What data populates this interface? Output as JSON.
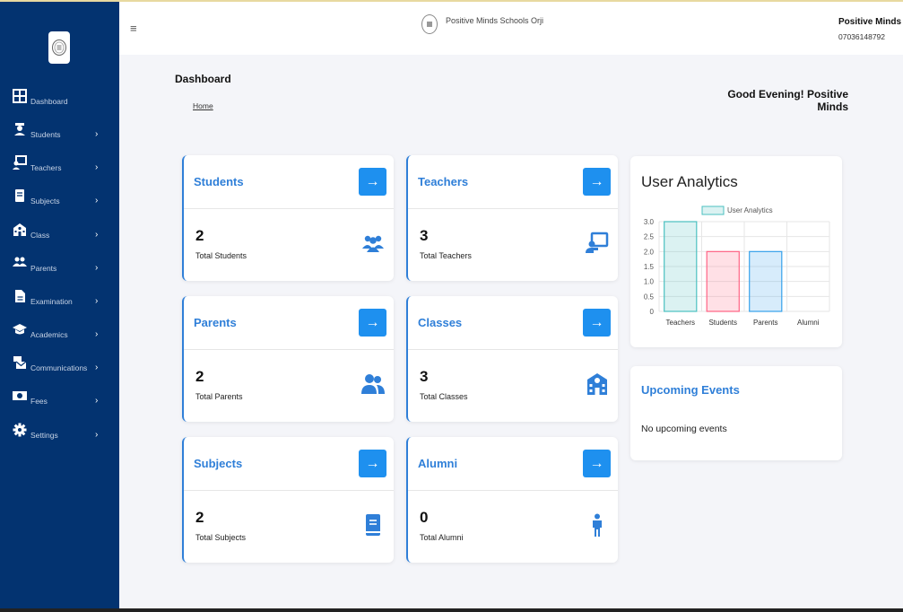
{
  "sidebar": {
    "items": [
      {
        "label": "Dashboard",
        "icon": "grid-icon",
        "chevron": ""
      },
      {
        "label": "Students",
        "icon": "student-icon",
        "chevron": "›"
      },
      {
        "label": "Teachers",
        "icon": "teacher-icon",
        "chevron": "›"
      },
      {
        "label": "Subjects",
        "icon": "book-icon",
        "chevron": "›"
      },
      {
        "label": "Class",
        "icon": "school-icon",
        "chevron": "›"
      },
      {
        "label": "Parents",
        "icon": "users-icon",
        "chevron": "›"
      },
      {
        "label": "Examination",
        "icon": "file-icon",
        "chevron": "›"
      },
      {
        "label": "Academics",
        "icon": "graduation-cap-icon",
        "chevron": "›"
      },
      {
        "label": "Communications",
        "icon": "mail-bulk-icon",
        "chevron": "›"
      },
      {
        "label": "Fees",
        "icon": "money-icon",
        "chevron": "›"
      },
      {
        "label": "Settings",
        "icon": "gear-icon",
        "chevron": "›"
      }
    ]
  },
  "header": {
    "menu_icon": "≡",
    "school_name": "Positive Minds Schools Orji",
    "user_name": "Positive Minds",
    "user_phone": "07036148792"
  },
  "page": {
    "title": "Dashboard",
    "breadcrumb": "Home",
    "greeting": "Good Evening! Positive Minds"
  },
  "cards": [
    {
      "title": "Students",
      "value": "2",
      "subtitle": "Total Students",
      "icon": "users-group-icon"
    },
    {
      "title": "Teachers",
      "value": "3",
      "subtitle": "Total Teachers",
      "icon": "chalkboard-teacher-icon"
    },
    {
      "title": "Parents",
      "value": "2",
      "subtitle": "Total Parents",
      "icon": "user-friends-icon"
    },
    {
      "title": "Classes",
      "value": "3",
      "subtitle": "Total Classes",
      "icon": "school-icon"
    },
    {
      "title": "Subjects",
      "value": "2",
      "subtitle": "Total Subjects",
      "icon": "book-icon"
    },
    {
      "title": "Alumni",
      "value": "0",
      "subtitle": "Total Alumni",
      "icon": "person-icon"
    }
  ],
  "arrow_glyph": "→",
  "analytics": {
    "title": "User Analytics"
  },
  "chart_data": {
    "type": "bar",
    "categories": [
      "Teachers",
      "Students",
      "Parents",
      "Alumni"
    ],
    "series": [
      {
        "name": "User Analytics",
        "values": [
          3,
          2,
          2,
          0
        ]
      }
    ],
    "colors": [
      "#4bc0c0",
      "#ff6384",
      "#36a2eb",
      "#ffcd56"
    ],
    "ylim": [
      0,
      3
    ],
    "yticks": [
      "3.0",
      "2.5",
      "2.0",
      "1.5",
      "1.0",
      "0.5",
      "0"
    ],
    "legend": "top",
    "grid": true
  },
  "events": {
    "title": "Upcoming Events",
    "empty_text": "No upcoming events"
  },
  "colors": {
    "sidebar": "#033370",
    "accent": "#2f7fd8",
    "button": "#1e90ef"
  }
}
